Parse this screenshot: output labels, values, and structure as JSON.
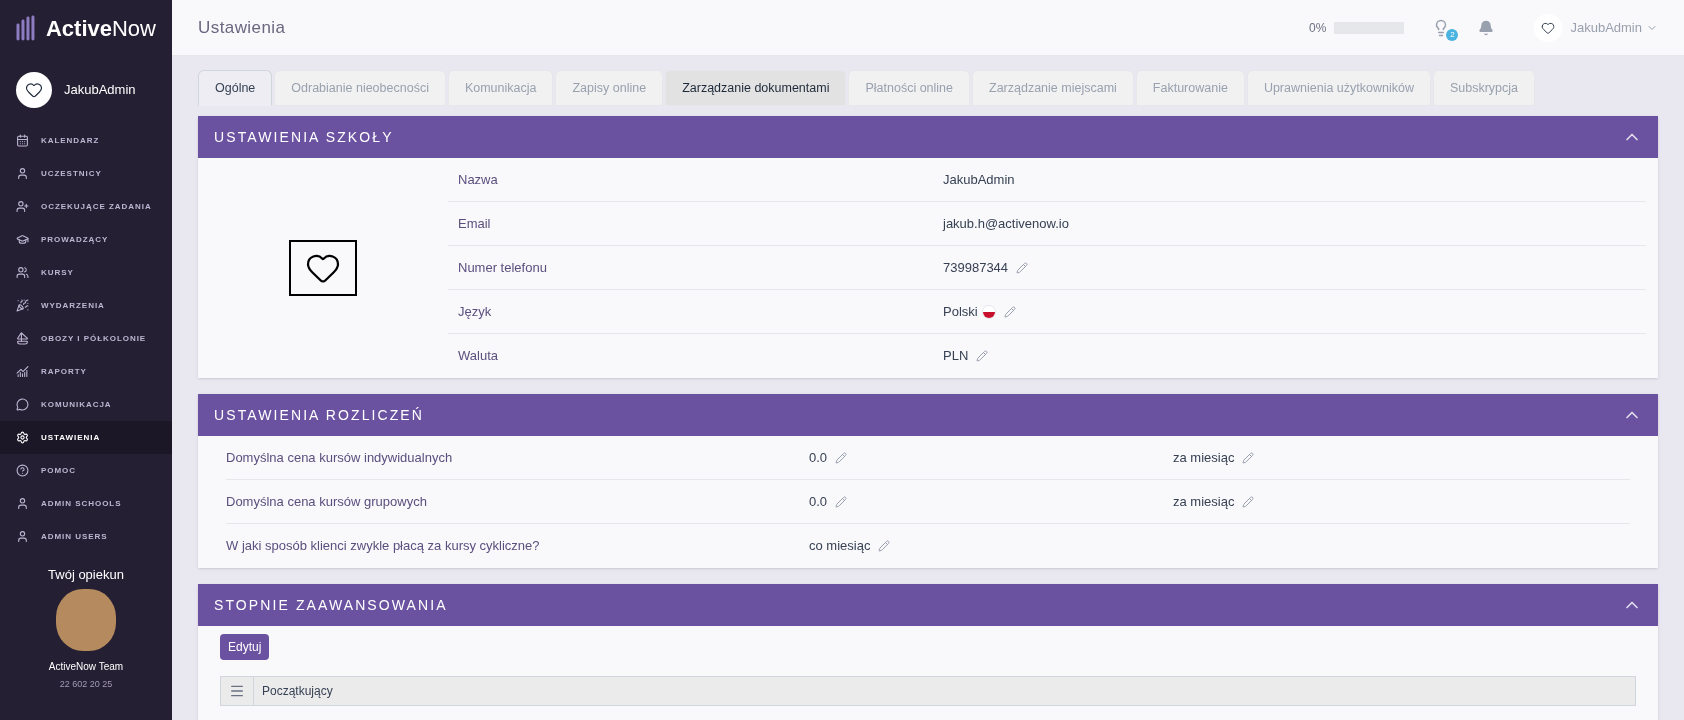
{
  "sidebar": {
    "logo": {
      "bold": "Active",
      "light": "Now"
    },
    "user": "JakubAdmin",
    "items": [
      {
        "label": "KALENDARZ",
        "selected": false
      },
      {
        "label": "UCZESTNICY",
        "selected": false
      },
      {
        "label": "OCZEKUJĄCE ZADANIA",
        "selected": false
      },
      {
        "label": "PROWADZĄCY",
        "selected": false
      },
      {
        "label": "KURSY",
        "selected": false
      },
      {
        "label": "WYDARZENIA",
        "selected": false
      },
      {
        "label": "OBOZY I PÓŁKOLONIE",
        "selected": false
      },
      {
        "label": "RAPORTY",
        "selected": false
      },
      {
        "label": "KOMUNIKACJA",
        "selected": false
      },
      {
        "label": "USTAWIENIA",
        "selected": true
      },
      {
        "label": "POMOC",
        "selected": false
      },
      {
        "label": "ADMIN SCHOOLS",
        "selected": false
      },
      {
        "label": "ADMIN USERS",
        "selected": false
      }
    ],
    "caretaker": {
      "title": "Twój opiekun",
      "name": "ActiveNow Team",
      "phone": "22 602 20 25"
    }
  },
  "topbar": {
    "title": "Ustawienia",
    "progress": {
      "reading": "0%",
      "level": 0
    },
    "tips_badge": "2",
    "user": "JakubAdmin"
  },
  "tabs": [
    {
      "label": "Ogólne",
      "selected": true,
      "hovered": false
    },
    {
      "label": "Odrabianie nieobecności",
      "selected": false,
      "hovered": false
    },
    {
      "label": "Komunikacja",
      "selected": false,
      "hovered": false
    },
    {
      "label": "Zapisy online",
      "selected": false,
      "hovered": false
    },
    {
      "label": "Zarządzanie dokumentami",
      "selected": false,
      "hovered": true
    },
    {
      "label": "Płatności online",
      "selected": false,
      "hovered": false
    },
    {
      "label": "Zarządzanie miejscami",
      "selected": false,
      "hovered": false
    },
    {
      "label": "Fakturowanie",
      "selected": false,
      "hovered": false
    },
    {
      "label": "Uprawnienia użytkowników",
      "selected": false,
      "hovered": false
    },
    {
      "label": "Subskrypcja",
      "selected": false,
      "hovered": false
    }
  ],
  "school_settings": {
    "title": "USTAWIENIA SZKOŁY",
    "expanded": true,
    "rows": [
      {
        "label": "Nazwa",
        "value": "JakubAdmin",
        "kind": "text"
      },
      {
        "label": "Email",
        "value": "jakub.h@activenow.io",
        "kind": "text"
      },
      {
        "label": "Numer telefonu",
        "value": "739987344",
        "kind": "editable"
      },
      {
        "label": "Język",
        "value": "Polski",
        "kind": "language"
      },
      {
        "label": "Waluta",
        "value": "PLN",
        "kind": "editable"
      }
    ]
  },
  "billing_settings": {
    "title": "USTAWIENIA ROZLICZEŃ",
    "expanded": true,
    "rows": [
      {
        "label": "Domyślna cena kursów indywidualnych",
        "value": "0.0",
        "unit": "za miesiąc"
      },
      {
        "label": "Domyślna cena kursów grupowych",
        "value": "0.0",
        "unit": "za miesiąc"
      },
      {
        "label": "W jaki sposób klienci zwykle płacą za kursy cykliczne?",
        "value": "co miesiąc"
      }
    ]
  },
  "levels": {
    "title": "STOPNIE ZAAWANSOWANIA",
    "expanded": true,
    "edit_button": "Edytuj",
    "items": [
      "Początkujący"
    ]
  }
}
